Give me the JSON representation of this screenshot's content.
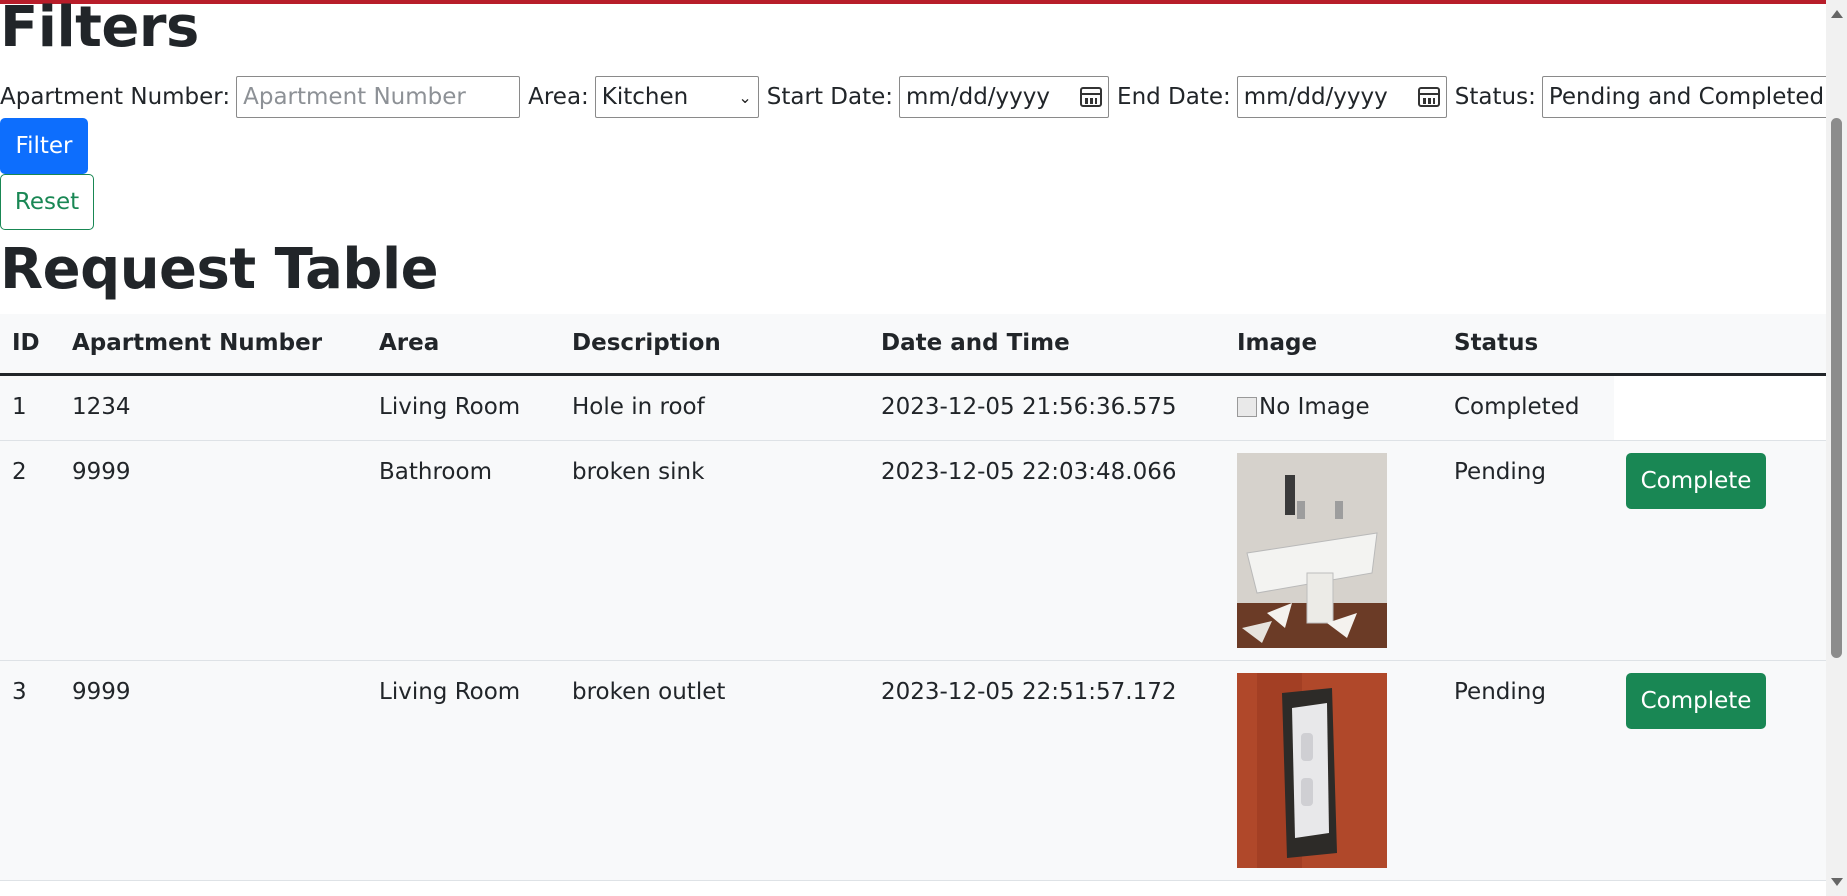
{
  "filters": {
    "title": "Filters",
    "apartment_label": "Apartment Number:",
    "apartment_placeholder": "Apartment Number",
    "area_label": "Area:",
    "area_value": "Kitchen",
    "start_label": "Start Date:",
    "start_value": "mm/dd/yyyy",
    "end_label": "End Date:",
    "end_value": "mm/dd/yyyy",
    "status_label": "Status:",
    "status_value": "Pending and Completed",
    "filter_button": "Filter",
    "reset_button": "Reset"
  },
  "table": {
    "title": "Request Table",
    "headers": [
      "ID",
      "Apartment Number",
      "Area",
      "Description",
      "Date and Time",
      "Image",
      "Status"
    ],
    "rows": [
      {
        "id": "1",
        "apartment": "1234",
        "area": "Living Room",
        "description": "Hole in roof",
        "datetime": "2023-12-05 21:56:36.575",
        "image_alt": "No Image",
        "status": "Completed"
      },
      {
        "id": "2",
        "apartment": "9999",
        "area": "Bathroom",
        "description": "broken sink",
        "datetime": "2023-12-05 22:03:48.066",
        "status": "Pending",
        "action": "Complete"
      },
      {
        "id": "3",
        "apartment": "9999",
        "area": "Living Room",
        "description": "broken outlet",
        "datetime": "2023-12-05 22:51:57.172",
        "status": "Pending",
        "action": "Complete"
      }
    ]
  },
  "colors": {
    "primary": "#0d6efd",
    "success": "#198754",
    "top_accent": "#b81d2a"
  }
}
